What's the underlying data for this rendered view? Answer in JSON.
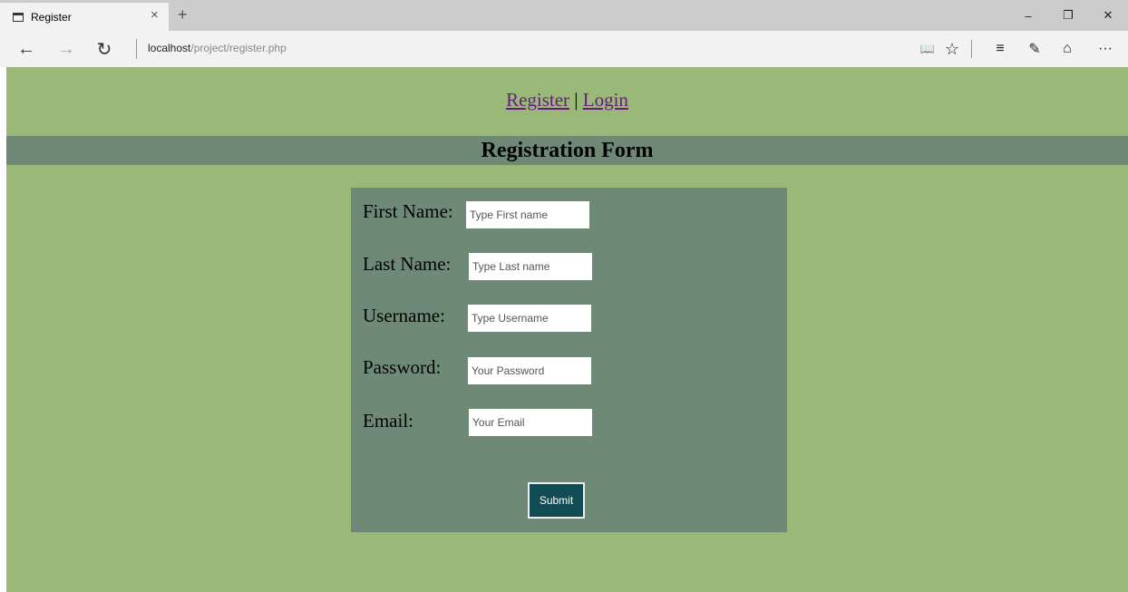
{
  "browser": {
    "tab_title": "Register",
    "tab_close": "×",
    "new_tab": "+",
    "address_host": "localhost",
    "address_path": "/project/register.php",
    "window": {
      "minimize": "–",
      "restore": "❐",
      "close": "✕"
    },
    "nav": {
      "back": "←",
      "forward": "→",
      "refresh": "↻"
    },
    "tools": {
      "reading": "📖",
      "favorite": "☆",
      "hub": "≡",
      "note": "✎",
      "share": "⌂",
      "more": "···"
    }
  },
  "page": {
    "links": {
      "register": "Register",
      "separator": "|",
      "login": "Login"
    },
    "heading": "Registration Form",
    "form": {
      "fields": [
        {
          "label": "First Name:",
          "placeholder": "Type First name"
        },
        {
          "label": "Last Name:",
          "placeholder": "Type Last name"
        },
        {
          "label": "Username:",
          "placeholder": "Type Username"
        },
        {
          "label": "Password:",
          "placeholder": "Your Password"
        },
        {
          "label": "Email:",
          "placeholder": "Your Email"
        }
      ],
      "submit": "Submit"
    }
  },
  "colors": {
    "page_bg": "#9ab979",
    "panel_bg": "#6e8a76",
    "button_bg": "#114c55",
    "link": "#6a1b80"
  }
}
